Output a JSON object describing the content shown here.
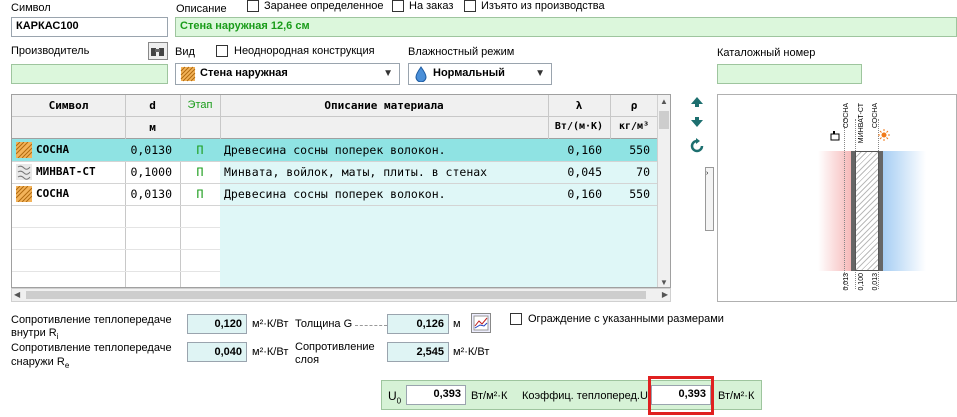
{
  "top": {
    "symbol_label": "Символ",
    "symbol_value": "КАРКАС100",
    "description_label": "Описание",
    "description_value": "Стена наружная 12,6 см",
    "predefined_label": "Заранее определенное",
    "on_order_label": "На заказ",
    "withdrawn_label": "Изъято из производства",
    "manufacturer_label": "Производитель",
    "manufacturer_value": "",
    "type_label": "Вид",
    "type_value": "Стена наружная",
    "nonuniform_label": "Неоднородная конструкция",
    "humidity_label": "Влажностный режим",
    "humidity_value": "Нормальный",
    "catalog_label": "Каталожный номер",
    "catalog_value": ""
  },
  "table": {
    "headers": [
      "Символ",
      "d",
      "Этап",
      "Описание материала",
      "λ",
      "ρ"
    ],
    "units": [
      "",
      "м",
      "",
      "",
      "Вт/(м·К)",
      "кг/м³"
    ],
    "rows": [
      {
        "symbol": "СОСНА",
        "d": "0,0130",
        "stage": "П",
        "desc": "Древесина сосны поперек волокон.",
        "lambda": "0,160",
        "rho": "550"
      },
      {
        "symbol": "МИНВАТ-СТ",
        "d": "0,1000",
        "stage": "П",
        "desc": "Минвата, войлок, маты, плиты. в стенах",
        "lambda": "0,045",
        "rho": "70"
      },
      {
        "symbol": "СОСНА",
        "d": "0,0130",
        "stage": "П",
        "desc": "Древесина сосны поперек волокон.",
        "lambda": "0,160",
        "rho": "550"
      }
    ]
  },
  "diagram": {
    "layer_labels": [
      "СОСНА",
      "МИНВАТ-СТ",
      "СОСНА"
    ],
    "thickness_labels": [
      "0,013",
      "0,100",
      "0,013"
    ]
  },
  "bottom": {
    "rsi_label_1": "Сопротивление теплопередаче",
    "rsi_label_2": "внутри R",
    "rsi_sub": "i",
    "rsi_value": "0,120",
    "rsi_unit": "м²·К/Вт",
    "rse_label_1": "Сопротивление теплопередаче",
    "rse_label_2": "снаружи R",
    "rse_sub": "e",
    "rse_value": "0,040",
    "rse_unit": "м²·К/Вт",
    "thickness_label": "Толщина G",
    "thickness_value": "0,126",
    "thickness_unit": "м",
    "layer_res_label_1": "Сопротивление",
    "layer_res_label_2": "слоя",
    "layer_res_value": "2,545",
    "layer_res_unit": "м²·К/Вт",
    "fence_label": "Ограждение с указанными размерами",
    "u0_label": "U",
    "u0_sub": "0",
    "u0_value": "0,393",
    "u0_unit": "Вт/м²·К",
    "u_label": "Коэффиц. теплоперед.U",
    "u_value": "0,393",
    "u_unit": "Вт/м²·К"
  }
}
